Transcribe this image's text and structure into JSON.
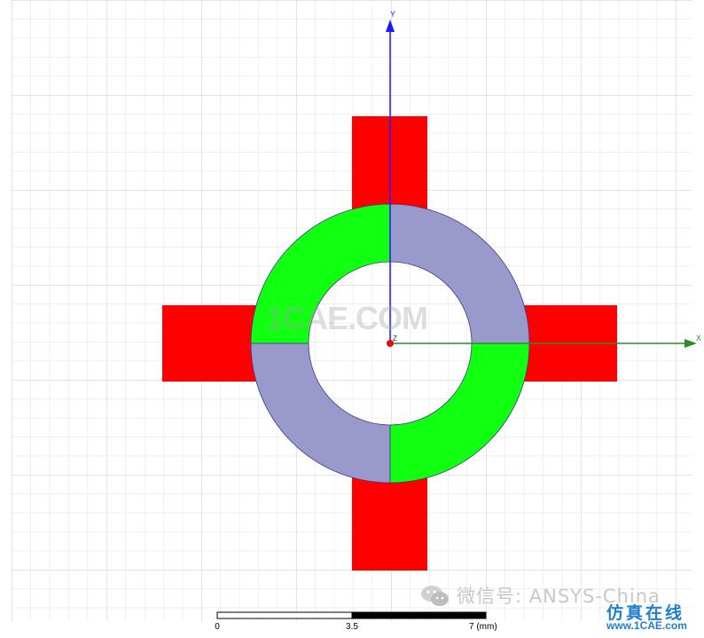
{
  "canvas": {
    "background": "#ffffff",
    "grid_color": "#dcdcdc"
  },
  "geometry_colors": {
    "ports": "#ff0000",
    "ring_green": "#11ff11",
    "ring_lavender": "#9999cc",
    "outline": "#3a3a8a"
  },
  "axes": {
    "x_label": "X",
    "y_label": "Y",
    "z_label": "Z",
    "x_color": "#2e8b2e",
    "y_color": "#1a1aff",
    "origin_color": "#e01010"
  },
  "scale_bar": {
    "ticks": [
      "0",
      "3.5",
      "7 (mm)"
    ]
  },
  "watermarks": {
    "center": "1CAE.COM",
    "wechat": "微信号: ANSYS-China",
    "brand_cn": "仿真在线",
    "brand_url": "www.1CAE.com"
  }
}
